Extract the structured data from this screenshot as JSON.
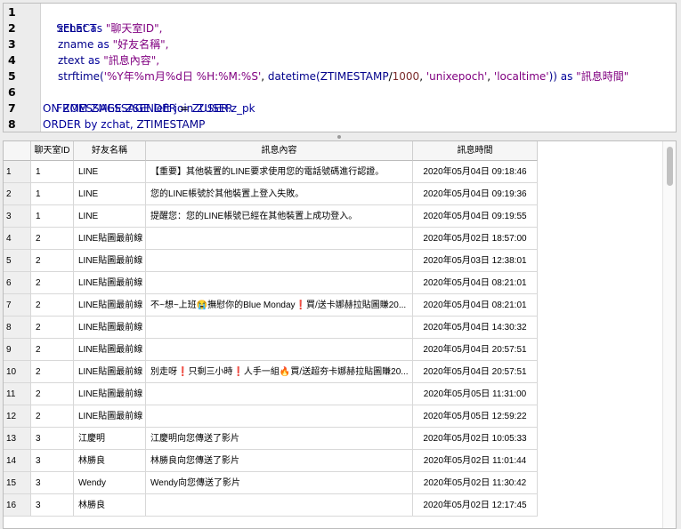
{
  "sql": {
    "line_numbers": [
      "1",
      "2",
      "3",
      "4",
      "5",
      "6",
      "7",
      "8"
    ],
    "select_kw": "SELECT",
    "l2_col": "zchat",
    "l2_as": "as",
    "l2_alias": "\"聊天室ID\",",
    "l3_col": "zname",
    "l3_as": "as",
    "l3_alias": "\"好友名稱\",",
    "l4_col": "ztext",
    "l4_as": "as",
    "l4_alias": "\"訊息內容\",",
    "l5_fn": "strftime(",
    "l5_fmt": "'%Y年%m月%d日 %H:%M:%S'",
    "l5_sep": ", ",
    "l5_fn2": "datetime(",
    "l5_arg": "ZTIMESTAMP",
    "l5_div": "/",
    "l5_num": "1000",
    "l5_c1": ", ",
    "l5_s2": "'unixepoch'",
    "l5_c2": ", ",
    "l5_s3": "'localtime'",
    "l5_close": "))",
    "l5_as": " as ",
    "l5_alias": "\"訊息時間\"",
    "l6": "FROM ZMESSAGE left join ZUSER",
    "l7_on": "ON ZMESSAGE.ZSENDER",
    "l7_eq": " = ",
    "l7_rhs": "ZUSER.z_pk",
    "l8_kw": "ORDER by zchat, ",
    "l8_col": "ZTIMESTAMP"
  },
  "grid": {
    "headers": [
      "聊天室ID",
      "好友名稱",
      "訊息內容",
      "訊息時間"
    ],
    "rows": [
      {
        "n": "1",
        "id": "1",
        "name": "LINE",
        "text": "【重要】其他裝置的LINE要求使用您的電話號碼進行認證。",
        "time": "2020年05月04日 09:18:46"
      },
      {
        "n": "2",
        "id": "1",
        "name": "LINE",
        "text": "您的LINE帳號於其他裝置上登入失敗。",
        "time": "2020年05月04日 09:19:36"
      },
      {
        "n": "3",
        "id": "1",
        "name": "LINE",
        "text": "提醒您：您的LINE帳號已經在其他裝置上成功登入。",
        "time": "2020年05月04日 09:19:55"
      },
      {
        "n": "4",
        "id": "2",
        "name": "LINE貼圖最前線",
        "text": "",
        "time": "2020年05月02日 18:57:00"
      },
      {
        "n": "5",
        "id": "2",
        "name": "LINE貼圖最前線",
        "text": "",
        "time": "2020年05月03日 12:38:01"
      },
      {
        "n": "6",
        "id": "2",
        "name": "LINE貼圖最前線",
        "text": "",
        "time": "2020年05月04日 08:21:01"
      },
      {
        "n": "7",
        "id": "2",
        "name": "LINE貼圖最前線",
        "text": "不~想~上班😭撫慰你的Blue Monday❗買/送卡娜赫拉貼圖賺20...",
        "time": "2020年05月04日 08:21:01"
      },
      {
        "n": "8",
        "id": "2",
        "name": "LINE貼圖最前線",
        "text": "",
        "time": "2020年05月04日 14:30:32"
      },
      {
        "n": "9",
        "id": "2",
        "name": "LINE貼圖最前線",
        "text": "",
        "time": "2020年05月04日 20:57:51"
      },
      {
        "n": "10",
        "id": "2",
        "name": "LINE貼圖最前線",
        "text": "別走呀❗只剩三小時❗人手一組🔥買/送超夯卡娜赫拉貼圖賺20...",
        "time": "2020年05月04日 20:57:51"
      },
      {
        "n": "11",
        "id": "2",
        "name": "LINE貼圖最前線",
        "text": "",
        "time": "2020年05月05日 11:31:00"
      },
      {
        "n": "12",
        "id": "2",
        "name": "LINE貼圖最前線",
        "text": "",
        "time": "2020年05月05日 12:59:22"
      },
      {
        "n": "13",
        "id": "3",
        "name": "江慶明",
        "text": "江慶明向您傳送了影片",
        "time": "2020年05月02日 10:05:33"
      },
      {
        "n": "14",
        "id": "3",
        "name": "林勝良",
        "text": "林勝良向您傳送了影片",
        "time": "2020年05月02日 11:01:44"
      },
      {
        "n": "15",
        "id": "3",
        "name": "Wendy",
        "text": "Wendy向您傳送了影片",
        "time": "2020年05月02日 11:30:42"
      },
      {
        "n": "16",
        "id": "3",
        "name": "林勝良",
        "text": "",
        "time": "2020年05月02日 12:17:45"
      }
    ]
  }
}
